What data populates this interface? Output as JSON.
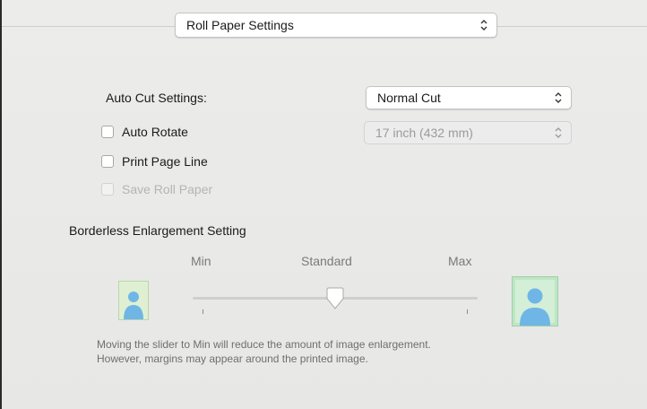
{
  "mode_popup": {
    "label": "Roll Paper Settings"
  },
  "auto_cut": {
    "label": "Auto Cut Settings:",
    "value": "Normal Cut"
  },
  "paper_size": {
    "value": "17 inch (432 mm)"
  },
  "checkboxes": [
    {
      "label": "Auto Rotate",
      "checked": false,
      "enabled": true
    },
    {
      "label": "Print Page Line",
      "checked": false,
      "enabled": true
    },
    {
      "label": "Save Roll Paper",
      "checked": false,
      "enabled": false
    }
  ],
  "enlargement": {
    "title": "Borderless Enlargement Setting",
    "min_label": "Min",
    "standard_label": "Standard",
    "max_label": "Max",
    "slider_value": "Standard"
  },
  "help_text": {
    "line1": "Moving the slider to Min will reduce the amount of image enlargement.",
    "line2": "However, margins may appear around the printed image."
  },
  "colors": {
    "icon_bg_small": "#dff0d2",
    "icon_bg_large": "#bfe6c4",
    "figure": "#6fb6e6"
  }
}
